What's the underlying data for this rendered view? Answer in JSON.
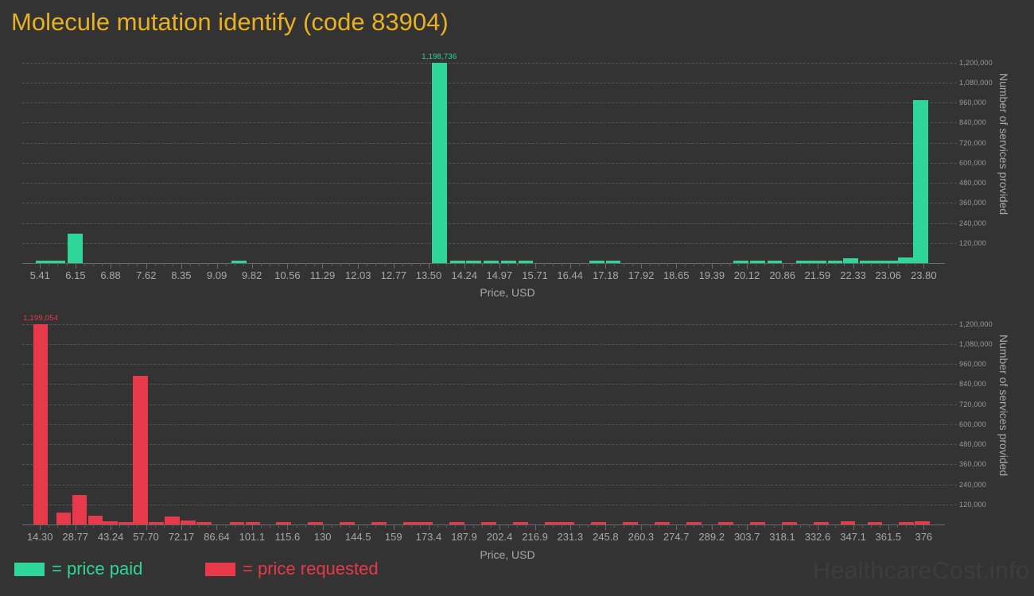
{
  "title": "Molecule mutation identify (code 83904)",
  "watermark": "HealthcareCost.info",
  "colors": {
    "background": "#333333",
    "title": "#e8b122",
    "paid": "#2ed69a",
    "requested": "#e8394a",
    "grid": "#565656",
    "tick_text": "#a8a8a8"
  },
  "legend": {
    "items": [
      {
        "key": "paid",
        "label": "= price paid",
        "color": "#2ed69a"
      },
      {
        "key": "requested",
        "label": "= price requested",
        "color": "#e8394a"
      }
    ]
  },
  "axis_titles": {
    "x": "Price, USD",
    "y": "Number of services provided"
  },
  "chart_data": [
    {
      "id": "price-paid-chart",
      "type": "bar",
      "title": "Molecule mutation identify (code 83904)",
      "series_name": "price paid",
      "color": "#2ed69a",
      "xlabel": "Price, USD",
      "ylabel": "Number of services provided",
      "ylim": [
        0,
        1260000
      ],
      "grid": true,
      "ytick_labels": [
        "120,000",
        "240,000",
        "360,000",
        "480,000",
        "600,000",
        "720,000",
        "840,000",
        "960,000",
        "1,080,000",
        "1,200,000"
      ],
      "ytick_values": [
        120000,
        240000,
        360000,
        480000,
        600000,
        720000,
        840000,
        960000,
        1080000,
        1200000
      ],
      "xtick_labels": [
        "5.41",
        "6.15",
        "6.88",
        "7.62",
        "8.35",
        "9.09",
        "9.82",
        "10.56",
        "11.29",
        "12.03",
        "12.77",
        "13.50",
        "14.24",
        "14.97",
        "15.71",
        "16.44",
        "17.18",
        "17.92",
        "18.65",
        "19.39",
        "20.12",
        "20.86",
        "21.59",
        "22.33",
        "23.06",
        "23.80"
      ],
      "xtick_values": [
        5.41,
        6.15,
        6.88,
        7.62,
        8.35,
        9.09,
        9.82,
        10.56,
        11.29,
        12.03,
        12.77,
        13.5,
        14.24,
        14.97,
        15.71,
        16.44,
        17.18,
        17.92,
        18.65,
        19.39,
        20.12,
        20.86,
        21.59,
        22.33,
        23.06,
        23.8
      ],
      "peak_label": {
        "text": "1,198,736",
        "x": 13.72,
        "y": 1198736
      },
      "bars": [
        {
          "x": 5.48,
          "y": 7000
        },
        {
          "x": 5.78,
          "y": 6000
        },
        {
          "x": 6.14,
          "y": 175000
        },
        {
          "x": 9.55,
          "y": 7000
        },
        {
          "x": 13.72,
          "y": 1198736
        },
        {
          "x": 14.1,
          "y": 6000
        },
        {
          "x": 14.44,
          "y": 6000
        },
        {
          "x": 14.8,
          "y": 6000
        },
        {
          "x": 15.16,
          "y": 6000
        },
        {
          "x": 15.52,
          "y": 6000
        },
        {
          "x": 17.0,
          "y": 6000
        },
        {
          "x": 17.34,
          "y": 5000
        },
        {
          "x": 20.0,
          "y": 6000
        },
        {
          "x": 20.34,
          "y": 6000
        },
        {
          "x": 20.7,
          "y": 6000
        },
        {
          "x": 21.3,
          "y": 6000
        },
        {
          "x": 21.62,
          "y": 6000
        },
        {
          "x": 21.96,
          "y": 6000
        },
        {
          "x": 22.28,
          "y": 30000
        },
        {
          "x": 22.62,
          "y": 7000
        },
        {
          "x": 22.92,
          "y": 6000
        },
        {
          "x": 23.18,
          "y": 7000
        },
        {
          "x": 23.42,
          "y": 32000
        },
        {
          "x": 23.74,
          "y": 975000
        }
      ]
    },
    {
      "id": "price-requested-chart",
      "type": "bar",
      "series_name": "price requested",
      "color": "#e8394a",
      "xlabel": "Price, USD",
      "ylabel": "Number of services provided",
      "ylim": [
        0,
        1260000
      ],
      "grid": true,
      "ytick_labels": [
        "120,000",
        "240,000",
        "360,000",
        "480,000",
        "600,000",
        "720,000",
        "840,000",
        "960,000",
        "1,080,000",
        "1,200,000"
      ],
      "ytick_values": [
        120000,
        240000,
        360000,
        480000,
        600000,
        720000,
        840000,
        960000,
        1080000,
        1200000
      ],
      "xtick_labels": [
        "14.30",
        "28.77",
        "43.24",
        "57.70",
        "72.17",
        "86.64",
        "101.1",
        "115.6",
        "130",
        "144.5",
        "159",
        "173.4",
        "187.9",
        "202.4",
        "216.9",
        "231.3",
        "245.8",
        "260.3",
        "274.7",
        "289.2",
        "303.7",
        "318.1",
        "332.6",
        "347.1",
        "361.5",
        "376"
      ],
      "xtick_values": [
        14.3,
        28.77,
        43.24,
        57.7,
        72.17,
        86.64,
        101.1,
        115.6,
        130,
        144.5,
        159,
        173.4,
        187.9,
        202.4,
        216.9,
        231.3,
        245.8,
        260.3,
        274.7,
        289.2,
        303.7,
        318.1,
        332.6,
        347.1,
        361.5,
        376
      ],
      "peak_label": {
        "text": "1,199,054",
        "x": 14.6,
        "y": 1199054
      },
      "bars": [
        {
          "x": 14.6,
          "y": 1199054
        },
        {
          "x": 24.0,
          "y": 70000
        },
        {
          "x": 30.5,
          "y": 175000
        },
        {
          "x": 37.0,
          "y": 50000
        },
        {
          "x": 43.0,
          "y": 20000
        },
        {
          "x": 49.5,
          "y": 8000
        },
        {
          "x": 55.5,
          "y": 890000
        },
        {
          "x": 62.0,
          "y": 9000
        },
        {
          "x": 68.5,
          "y": 48000
        },
        {
          "x": 75.0,
          "y": 22000
        },
        {
          "x": 81.5,
          "y": 9000
        },
        {
          "x": 95.0,
          "y": 9000
        },
        {
          "x": 101.5,
          "y": 9000
        },
        {
          "x": 114.0,
          "y": 9000
        },
        {
          "x": 127.0,
          "y": 9000
        },
        {
          "x": 140.0,
          "y": 9000
        },
        {
          "x": 153.0,
          "y": 9000
        },
        {
          "x": 166.0,
          "y": 9000
        },
        {
          "x": 172.0,
          "y": 9000
        },
        {
          "x": 185.0,
          "y": 9000
        },
        {
          "x": 198.0,
          "y": 9000
        },
        {
          "x": 211.0,
          "y": 9000
        },
        {
          "x": 224.0,
          "y": 9000
        },
        {
          "x": 230.0,
          "y": 16000
        },
        {
          "x": 243.0,
          "y": 9000
        },
        {
          "x": 256.0,
          "y": 9000
        },
        {
          "x": 269.0,
          "y": 9000
        },
        {
          "x": 282.0,
          "y": 9000
        },
        {
          "x": 295.0,
          "y": 9000
        },
        {
          "x": 308.0,
          "y": 9000
        },
        {
          "x": 321.0,
          "y": 9000
        },
        {
          "x": 334.0,
          "y": 9000
        },
        {
          "x": 345.0,
          "y": 17000
        },
        {
          "x": 356.0,
          "y": 9000
        },
        {
          "x": 369.0,
          "y": 9000
        },
        {
          "x": 375.5,
          "y": 17000
        }
      ]
    }
  ]
}
